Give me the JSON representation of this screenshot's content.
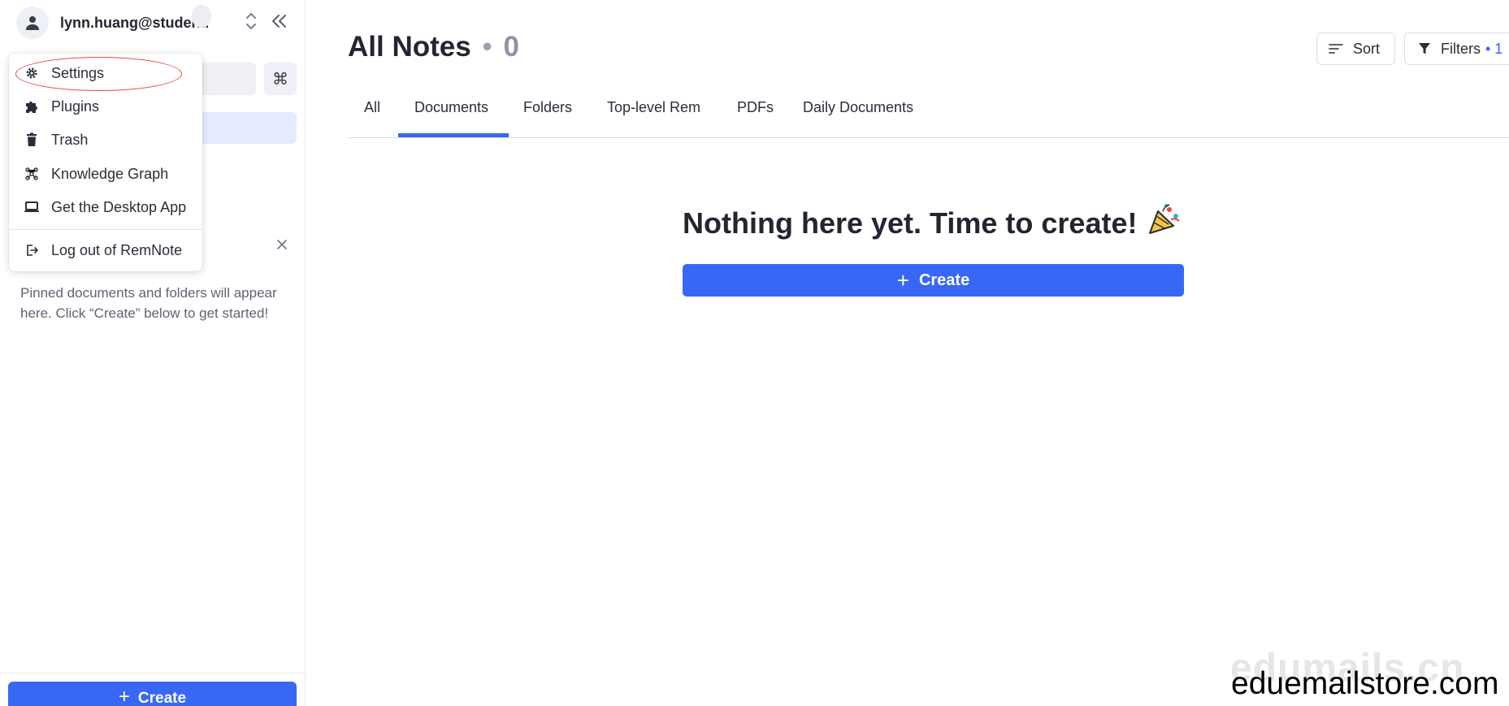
{
  "account": {
    "email": "lynn.huang@student."
  },
  "search": {
    "shortcut_glyph": "⌘"
  },
  "menu": {
    "items": [
      {
        "label": "Settings",
        "icon": "gear-icon"
      },
      {
        "label": "Plugins",
        "icon": "puzzle-icon"
      },
      {
        "label": "Trash",
        "icon": "trash-icon"
      },
      {
        "label": "Knowledge Graph",
        "icon": "graph-icon"
      },
      {
        "label": "Get the Desktop App",
        "icon": "laptop-icon"
      },
      {
        "label": "Log out of RemNote",
        "icon": "logout-icon"
      }
    ]
  },
  "sidebar": {
    "pinned_empty_text": "Pinned documents and folders will appear here. Click “Create” below to get started!",
    "create_label": "Create"
  },
  "main": {
    "title": "All Notes",
    "title_sep": "•",
    "count": "0",
    "sort_label": "Sort",
    "filters_label": "Filters",
    "filters_count": "• 1",
    "tabs": [
      {
        "label": "All",
        "active": false
      },
      {
        "label": "Documents",
        "active": true
      },
      {
        "label": "Folders",
        "active": false
      },
      {
        "label": "Top-level Rem",
        "active": false
      },
      {
        "label": "PDFs",
        "active": false
      },
      {
        "label": "Daily Documents",
        "active": false
      }
    ],
    "empty_title": "Nothing here yet. Time to create!",
    "empty_emoji": "🎉",
    "create_label": "Create"
  },
  "colors": {
    "accent": "#3867f6",
    "annotation": "#e14848"
  },
  "watermark": {
    "faint": "edumails.cn",
    "text": "eduemailstore.com"
  }
}
